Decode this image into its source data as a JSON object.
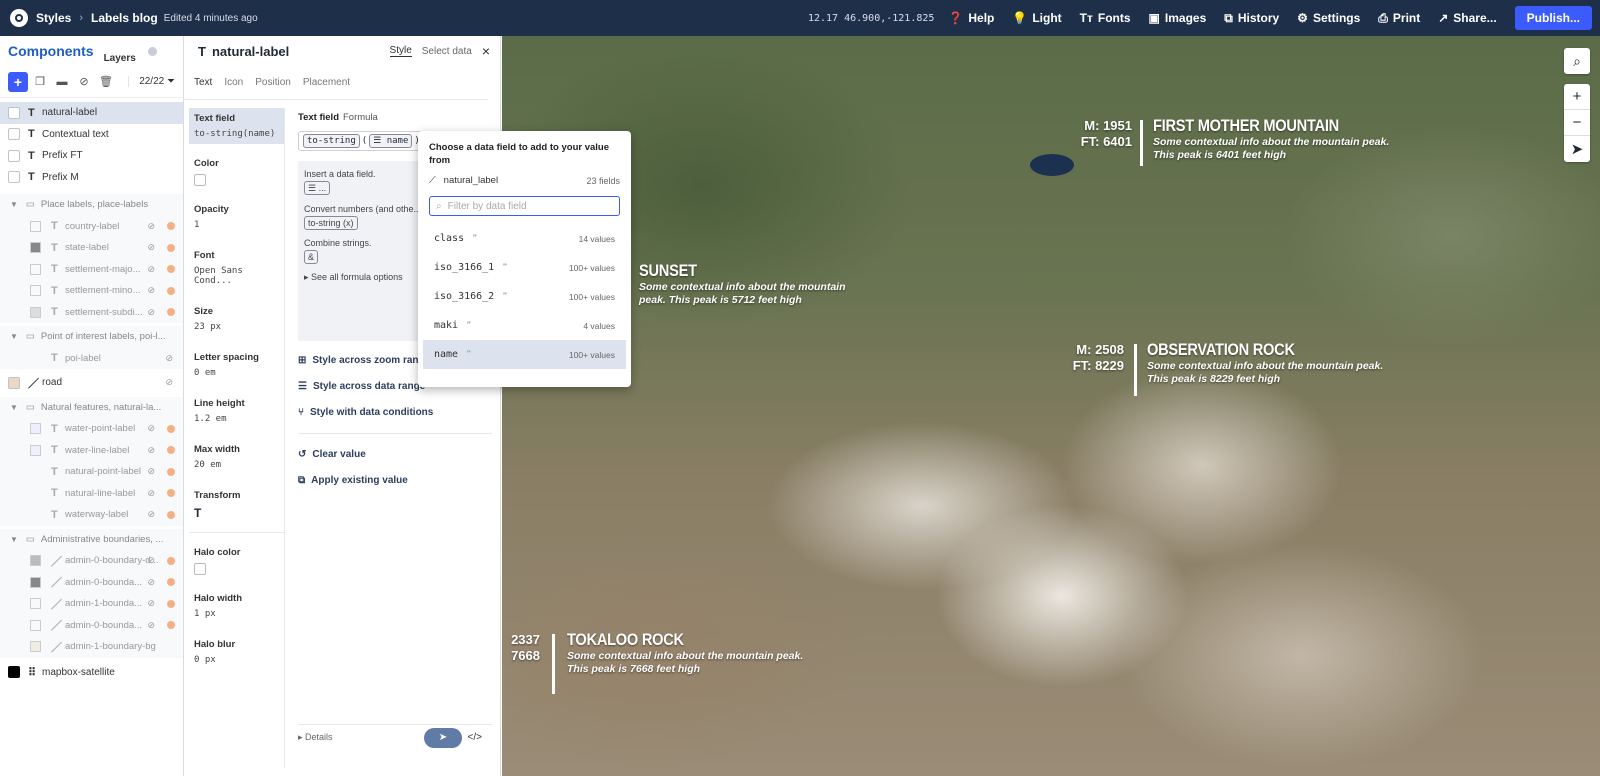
{
  "topbar": {
    "crumb1": "Styles",
    "crumb2": "Labels blog",
    "edited": "Edited 4 minutes ago",
    "coords": "12.17 46.900,-121.825",
    "help": "Help",
    "theme": "Light",
    "fonts": "Fonts",
    "images": "Images",
    "history": "History",
    "settings": "Settings",
    "print": "Print",
    "share": "Share...",
    "publish": "Publish..."
  },
  "left": {
    "tab_components": "Components",
    "tab_layers": "Layers",
    "count": "22/22",
    "layers": [
      {
        "label": "natural-label"
      },
      {
        "label": "Contextual text"
      },
      {
        "label": "Prefix FT"
      },
      {
        "label": "Prefix M"
      }
    ],
    "group_place": "Place labels, place-labels",
    "place": [
      "country-label",
      "state-label",
      "settlement-majo...",
      "settlement-mino...",
      "settlement-subdi..."
    ],
    "group_poi": "Point of interest labels, poi-l...",
    "poi": [
      "poi-label"
    ],
    "road": "road",
    "group_natural": "Natural features, natural-la...",
    "natural": [
      "water-point-label",
      "water-line-label",
      "natural-point-label",
      "natural-line-label",
      "waterway-label"
    ],
    "group_admin": "Administrative boundaries, ...",
    "admin": [
      "admin-0-boundary-d...",
      "admin-0-bounda...",
      "admin-1-bounda...",
      "admin-0-bounda...",
      "admin-1-boundary-bg"
    ],
    "satellite": "mapbox-satellite"
  },
  "panel": {
    "layer_name": "natural-label",
    "tab_style": "Style",
    "tab_select": "Select data",
    "subtabs": [
      "Text",
      "Icon",
      "Position",
      "Placement"
    ],
    "props": [
      {
        "label": "Text field",
        "value": "to-string(name)"
      },
      {
        "label": "Color",
        "value": ""
      },
      {
        "label": "Opacity",
        "value": "1"
      },
      {
        "label": "Font",
        "value": "Open Sans Cond..."
      },
      {
        "label": "Size",
        "value": "23 px"
      },
      {
        "label": "Letter spacing",
        "value": "0 em"
      },
      {
        "label": "Line height",
        "value": "1.2 em"
      },
      {
        "label": "Max width",
        "value": "20 em"
      },
      {
        "label": "Transform",
        "value": "T"
      },
      {
        "label": "Halo color",
        "value": ""
      },
      {
        "label": "Halo width",
        "value": "1 px"
      },
      {
        "label": "Halo blur",
        "value": "0 px"
      }
    ],
    "editor_title": "Text field",
    "editor_formula": "Formula",
    "expr_fn": "to-string",
    "expr_field": "name",
    "help1": "Insert a data field.",
    "help1_tok": "...",
    "help2": "Convert numbers (and othe... strings.",
    "help2_tok": "to-string (x)",
    "help3": "Combine strings.",
    "help3_tok": "&",
    "see_all": "See all formula options",
    "act_zoom": "Style across zoom rang...",
    "act_data": "Style across data range",
    "act_cond": "Style with data conditions",
    "clear": "Clear value",
    "apply": "Apply existing value",
    "details": "Details"
  },
  "dropdown": {
    "title": "Choose a data field to add to your value from",
    "source": "natural_label",
    "source_count": "23 fields",
    "filter_placeholder": "Filter by data field",
    "fields": [
      {
        "name": "class",
        "count": "14 values"
      },
      {
        "name": "iso_3166_1",
        "count": "100+ values"
      },
      {
        "name": "iso_3166_2",
        "count": "100+ values"
      },
      {
        "name": "maki",
        "count": "4 values"
      },
      {
        "name": "name",
        "count": "100+ values"
      }
    ]
  },
  "map": {
    "labels": [
      {
        "name": "FIRST MOTHER MOUNTAIN",
        "m": "M:  1951",
        "ft": "FT:  6401",
        "desc": "Some contextual info about the mountain peak. This peak is 6401 feet high"
      },
      {
        "name": "SUNSET",
        "desc": "Some contextual info about the mountain peak. This peak is 5712 feet high"
      },
      {
        "name": "OBSERVATION ROCK",
        "m": "M:  2508",
        "ft": "FT:  8229",
        "desc": "Some contextual info about the mountain peak. This peak is 8229 feet high"
      },
      {
        "name": "TOKALOO ROCK",
        "m": "2337",
        "ft": "7668",
        "desc": "Some contextual info about the mountain peak. This peak is 7668 feet high"
      }
    ]
  }
}
